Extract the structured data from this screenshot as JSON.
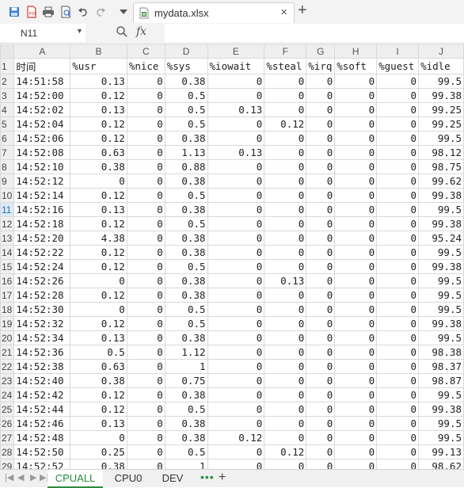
{
  "toolbar": {
    "icons": [
      "save-icon",
      "export-pdf-icon",
      "print-icon",
      "print-preview-icon",
      "undo-icon",
      "redo-icon",
      "customize-toolbar-icon"
    ],
    "file_tab": {
      "name": "mydata.xlsx",
      "close": "×"
    },
    "new_tab": "+"
  },
  "formula_bar": {
    "cell_ref": "N11",
    "fx": "fx",
    "value": ""
  },
  "grid": {
    "col_letters": [
      "A",
      "B",
      "C",
      "D",
      "E",
      "F",
      "G",
      "H",
      "I",
      "J"
    ],
    "row_numbers": [
      "1",
      "2",
      "3",
      "4",
      "5",
      "6",
      "7",
      "8",
      "9",
      "10",
      "11",
      "12",
      "13",
      "14",
      "15",
      "16",
      "17",
      "18",
      "19",
      "20",
      "21",
      "22",
      "23",
      "24",
      "25",
      "26",
      "27",
      "28",
      "29"
    ],
    "selected_row": 11,
    "header": [
      "时间",
      "%usr",
      "%nice",
      "%sys",
      "%iowait",
      "%steal",
      "%irq",
      "%soft",
      "%guest",
      "%idle"
    ],
    "rows": [
      [
        "14:51:58",
        "0.13",
        "0",
        "0.38",
        "0",
        "0",
        "0",
        "0",
        "0",
        "99.5"
      ],
      [
        "14:52:00",
        "0.12",
        "0",
        "0.5",
        "0",
        "0",
        "0",
        "0",
        "0",
        "99.38"
      ],
      [
        "14:52:02",
        "0.13",
        "0",
        "0.5",
        "0.13",
        "0",
        "0",
        "0",
        "0",
        "99.25"
      ],
      [
        "14:52:04",
        "0.12",
        "0",
        "0.5",
        "0",
        "0.12",
        "0",
        "0",
        "0",
        "99.25"
      ],
      [
        "14:52:06",
        "0.12",
        "0",
        "0.38",
        "0",
        "0",
        "0",
        "0",
        "0",
        "99.5"
      ],
      [
        "14:52:08",
        "0.63",
        "0",
        "1.13",
        "0.13",
        "0",
        "0",
        "0",
        "0",
        "98.12"
      ],
      [
        "14:52:10",
        "0.38",
        "0",
        "0.88",
        "0",
        "0",
        "0",
        "0",
        "0",
        "98.75"
      ],
      [
        "14:52:12",
        "0",
        "0",
        "0.38",
        "0",
        "0",
        "0",
        "0",
        "0",
        "99.62"
      ],
      [
        "14:52:14",
        "0.12",
        "0",
        "0.5",
        "0",
        "0",
        "0",
        "0",
        "0",
        "99.38"
      ],
      [
        "14:52:16",
        "0.13",
        "0",
        "0.38",
        "0",
        "0",
        "0",
        "0",
        "0",
        "99.5"
      ],
      [
        "14:52:18",
        "0.12",
        "0",
        "0.5",
        "0",
        "0",
        "0",
        "0",
        "0",
        "99.38"
      ],
      [
        "14:52:20",
        "4.38",
        "0",
        "0.38",
        "0",
        "0",
        "0",
        "0",
        "0",
        "95.24"
      ],
      [
        "14:52:22",
        "0.12",
        "0",
        "0.38",
        "0",
        "0",
        "0",
        "0",
        "0",
        "99.5"
      ],
      [
        "14:52:24",
        "0.12",
        "0",
        "0.5",
        "0",
        "0",
        "0",
        "0",
        "0",
        "99.38"
      ],
      [
        "14:52:26",
        "0",
        "0",
        "0.38",
        "0",
        "0.13",
        "0",
        "0",
        "0",
        "99.5"
      ],
      [
        "14:52:28",
        "0.12",
        "0",
        "0.38",
        "0",
        "0",
        "0",
        "0",
        "0",
        "99.5"
      ],
      [
        "14:52:30",
        "0",
        "0",
        "0.5",
        "0",
        "0",
        "0",
        "0",
        "0",
        "99.5"
      ],
      [
        "14:52:32",
        "0.12",
        "0",
        "0.5",
        "0",
        "0",
        "0",
        "0",
        "0",
        "99.38"
      ],
      [
        "14:52:34",
        "0.13",
        "0",
        "0.38",
        "0",
        "0",
        "0",
        "0",
        "0",
        "99.5"
      ],
      [
        "14:52:36",
        "0.5",
        "0",
        "1.12",
        "0",
        "0",
        "0",
        "0",
        "0",
        "98.38"
      ],
      [
        "14:52:38",
        "0.63",
        "0",
        "1",
        "0",
        "0",
        "0",
        "0",
        "0",
        "98.37"
      ],
      [
        "14:52:40",
        "0.38",
        "0",
        "0.75",
        "0",
        "0",
        "0",
        "0",
        "0",
        "98.87"
      ],
      [
        "14:52:42",
        "0.12",
        "0",
        "0.38",
        "0",
        "0",
        "0",
        "0",
        "0",
        "99.5"
      ],
      [
        "14:52:44",
        "0.12",
        "0",
        "0.5",
        "0",
        "0",
        "0",
        "0",
        "0",
        "99.38"
      ],
      [
        "14:52:46",
        "0.13",
        "0",
        "0.38",
        "0",
        "0",
        "0",
        "0",
        "0",
        "99.5"
      ],
      [
        "14:52:48",
        "0",
        "0",
        "0.38",
        "0.12",
        "0",
        "0",
        "0",
        "0",
        "99.5"
      ],
      [
        "14:52:50",
        "0.25",
        "0",
        "0.5",
        "0",
        "0.12",
        "0",
        "0",
        "0",
        "99.13"
      ],
      [
        "14:52:52",
        "0.38",
        "0",
        "1",
        "0",
        "0",
        "0",
        "0",
        "0",
        "98.62"
      ]
    ]
  },
  "sheets": {
    "tabs": [
      "CPUALL",
      "CPU0",
      "DEV"
    ],
    "active": "CPUALL",
    "more": "•••",
    "add": "+"
  }
}
